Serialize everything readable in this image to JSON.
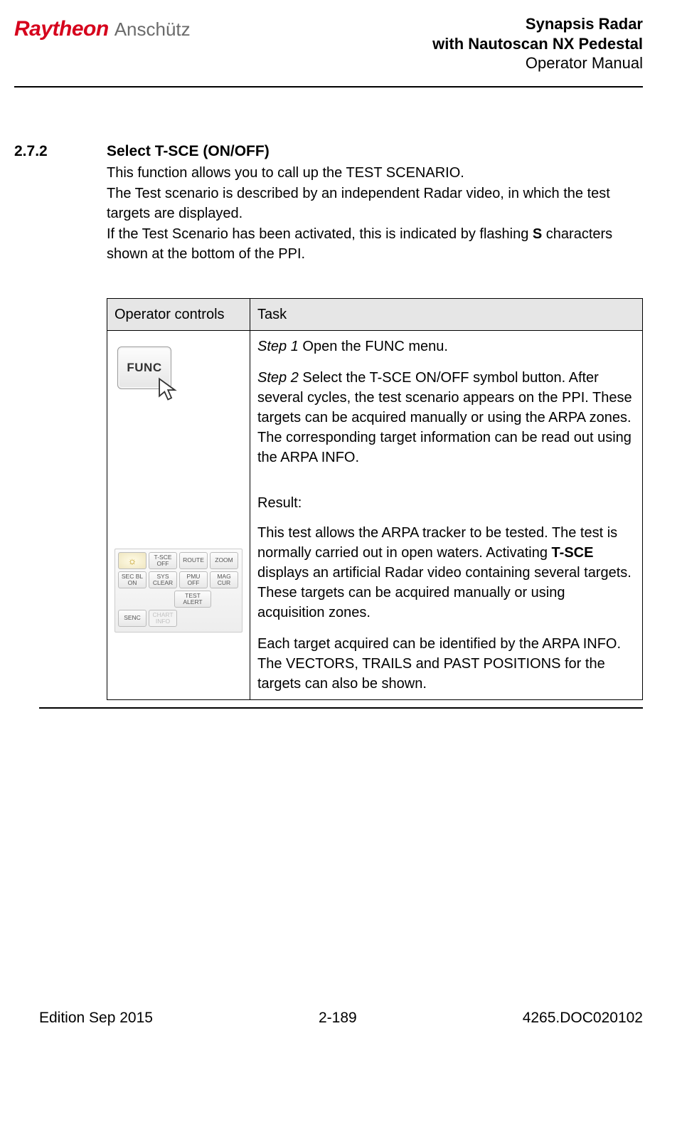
{
  "logo": {
    "primary": "Raytheon",
    "secondary": "Anschütz"
  },
  "header": {
    "line1": "Synapsis Radar",
    "line2": "with Nautoscan NX Pedestal",
    "line3": "Operator Manual"
  },
  "section": {
    "number": "2.7.2",
    "title": "Select T-SCE (ON/OFF)",
    "p1": "This function allows you to call up the TEST SCENARIO.",
    "p2": "The Test scenario is described by an independent Radar video, in which the test targets are displayed.",
    "p3a": "If the Test Scenario has been activated, this is indicated by flashing ",
    "p3b": "S",
    "p3c": " characters shown at the bottom of the PPI."
  },
  "table_headers": {
    "col1": "Operator controls",
    "col2": "Task"
  },
  "func_label": "FUNC",
  "panel": {
    "r1": [
      "☼",
      "T-SCE OFF",
      "ROUTE",
      "ZOOM"
    ],
    "r2": [
      "SEC BL ON",
      "SYS CLEAR",
      "PMU OFF",
      "MAG CUR"
    ],
    "r3": [
      "TEST ALERT"
    ],
    "r4": [
      "SENC",
      "CHART INFO"
    ]
  },
  "task": {
    "step1_label": "Step 1",
    "step1_text": " Open the FUNC menu.",
    "step2_label": "Step 2",
    "step2_text": " Select the T-SCE ON/OFF symbol button. After several cycles, the test scenario appears on the PPI. These targets can be acquired manually or using the ARPA zones. The corresponding target information can be read out using the ARPA INFO.",
    "result_label": "Result:",
    "result_p1a": "This test allows the ARPA tracker to be tested. The test is normally carried out in open waters. Activating ",
    "result_p1b": "T-SCE",
    "result_p1c": " displays an artificial Radar video containing several targets. These targets can be acquired manually or using acquisition zones.",
    "result_p2": "Each target acquired can be identified by the ARPA INFO.",
    "result_p3": "The VECTORS, TRAILS and PAST POSITIONS for the targets can also be shown."
  },
  "footer": {
    "left": "Edition Sep 2015",
    "center": "2-189",
    "right": "4265.DOC020102"
  }
}
